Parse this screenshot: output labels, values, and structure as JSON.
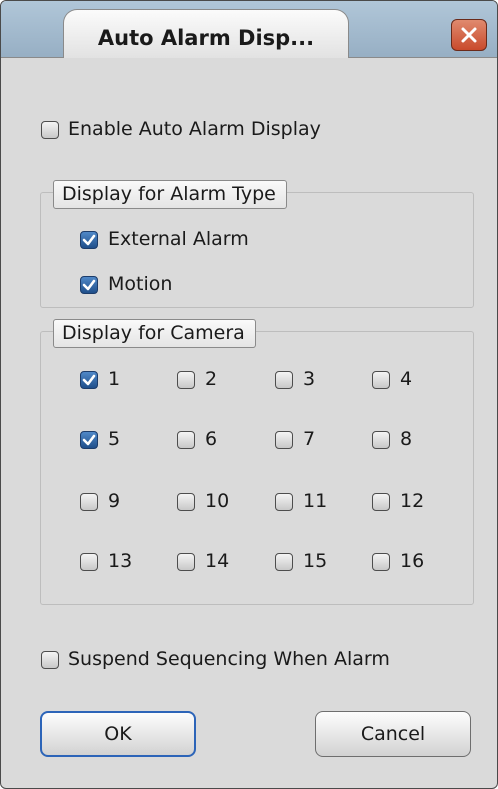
{
  "window": {
    "title": "Auto Alarm Disp..."
  },
  "enable_auto_alarm": {
    "label": "Enable Auto Alarm Display",
    "checked": false
  },
  "alarm_type_group": {
    "title": "Display for Alarm Type",
    "items": [
      {
        "label": "External Alarm",
        "checked": true
      },
      {
        "label": "Motion",
        "checked": true
      }
    ]
  },
  "camera_group": {
    "title": "Display for Camera",
    "cameras": [
      {
        "label": "1",
        "checked": true
      },
      {
        "label": "2",
        "checked": false
      },
      {
        "label": "3",
        "checked": false
      },
      {
        "label": "4",
        "checked": false
      },
      {
        "label": "5",
        "checked": true
      },
      {
        "label": "6",
        "checked": false
      },
      {
        "label": "7",
        "checked": false
      },
      {
        "label": "8",
        "checked": false
      },
      {
        "label": "9",
        "checked": false
      },
      {
        "label": "10",
        "checked": false
      },
      {
        "label": "11",
        "checked": false
      },
      {
        "label": "12",
        "checked": false
      },
      {
        "label": "13",
        "checked": false
      },
      {
        "label": "14",
        "checked": false
      },
      {
        "label": "15",
        "checked": false
      },
      {
        "label": "16",
        "checked": false
      }
    ]
  },
  "suspend_sequencing": {
    "label": "Suspend Sequencing When Alarm",
    "checked": false
  },
  "buttons": {
    "ok": "OK",
    "cancel": "Cancel"
  }
}
